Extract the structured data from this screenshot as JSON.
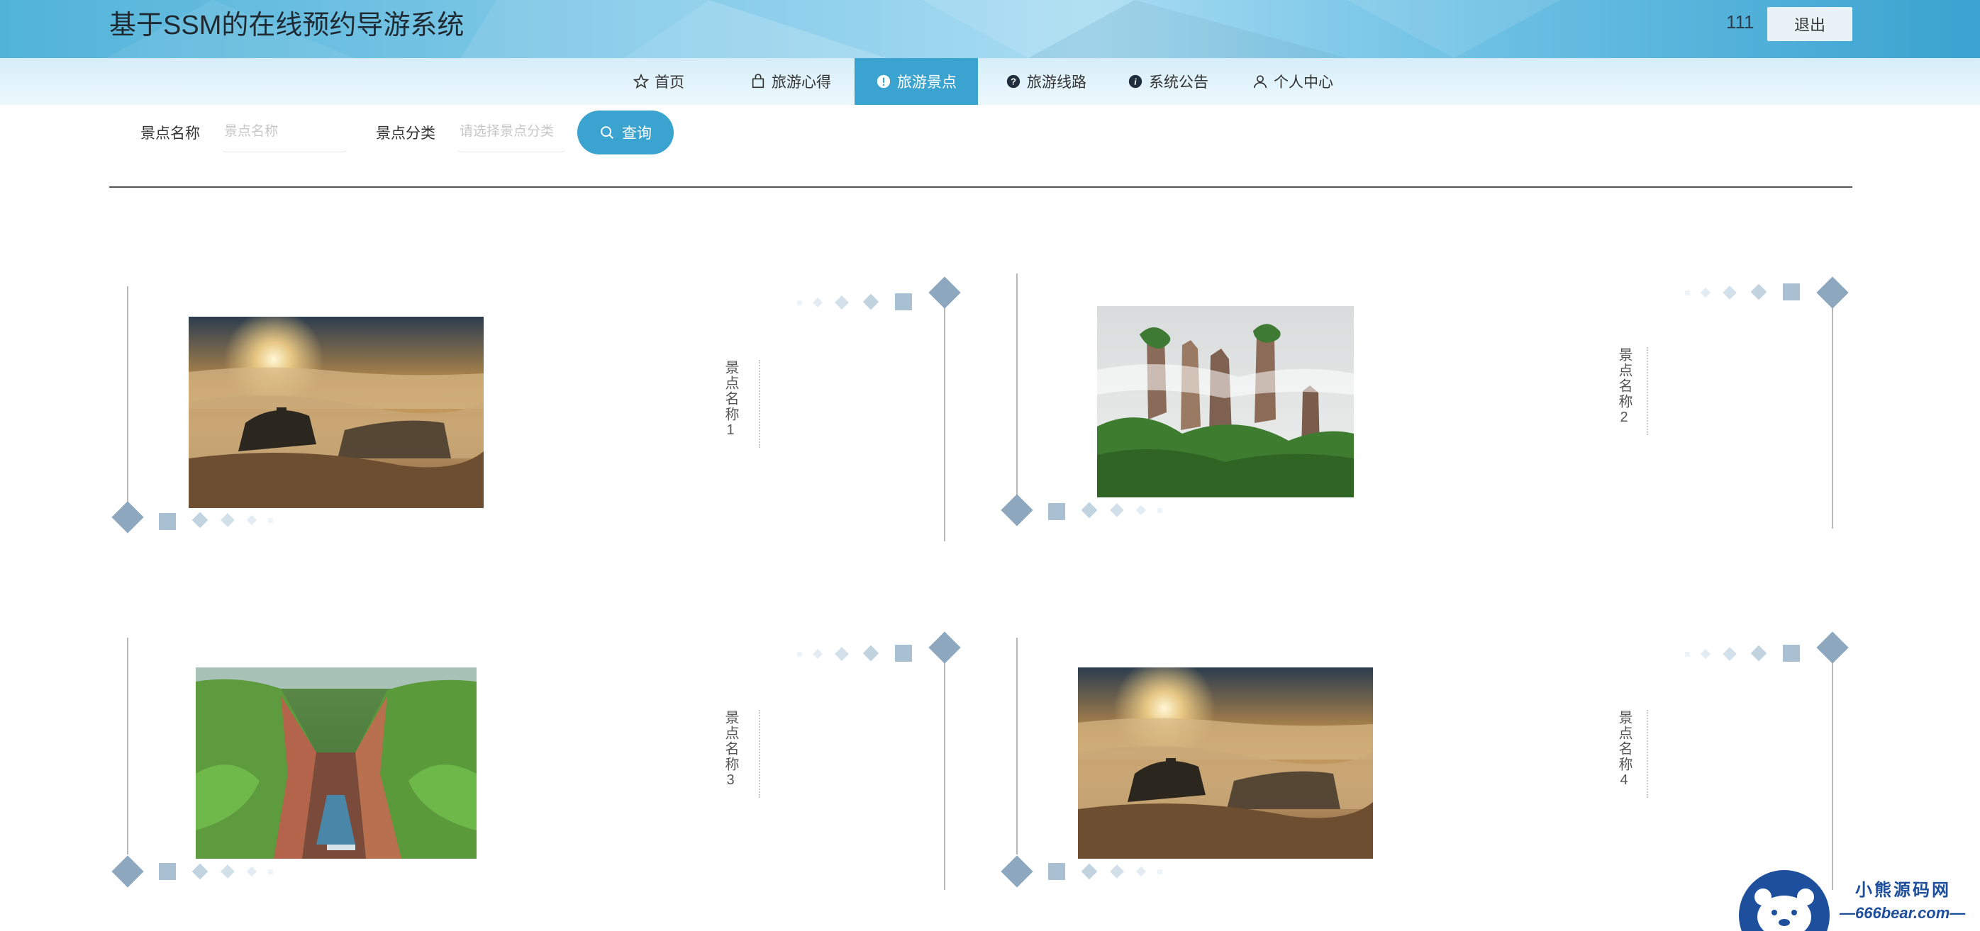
{
  "header": {
    "title": "基于SSM的在线预约导游系统",
    "username": "111",
    "logout_label": "退出",
    "accent_color": "#3aa3cf"
  },
  "nav": {
    "items": [
      {
        "label": "首页",
        "icon": "star-icon"
      },
      {
        "label": "旅游心得",
        "icon": "bag-icon"
      },
      {
        "label": "旅游景点",
        "icon": "info-icon",
        "active": true
      },
      {
        "label": "旅游线路",
        "icon": "question-icon"
      },
      {
        "label": "系统公告",
        "icon": "info-icon"
      },
      {
        "label": "个人中心",
        "icon": "user-icon"
      }
    ]
  },
  "search": {
    "name_label": "景点名称",
    "name_placeholder": "景点名称",
    "category_label": "景点分类",
    "category_placeholder": "请选择景点分类",
    "button_label": "查询",
    "button_icon": "search-icon"
  },
  "spots": [
    {
      "name": "景点名称1",
      "photo": "sunrise-clouds-photo"
    },
    {
      "name": "景点名称2",
      "photo": "stone-pillars-photo"
    },
    {
      "name": "景点名称3",
      "photo": "canyon-photo"
    },
    {
      "name": "景点名称4",
      "photo": "sunrise-clouds-photo"
    }
  ],
  "watermark": {
    "line1": "小熊源码网",
    "line2": "—666bear.com—"
  }
}
